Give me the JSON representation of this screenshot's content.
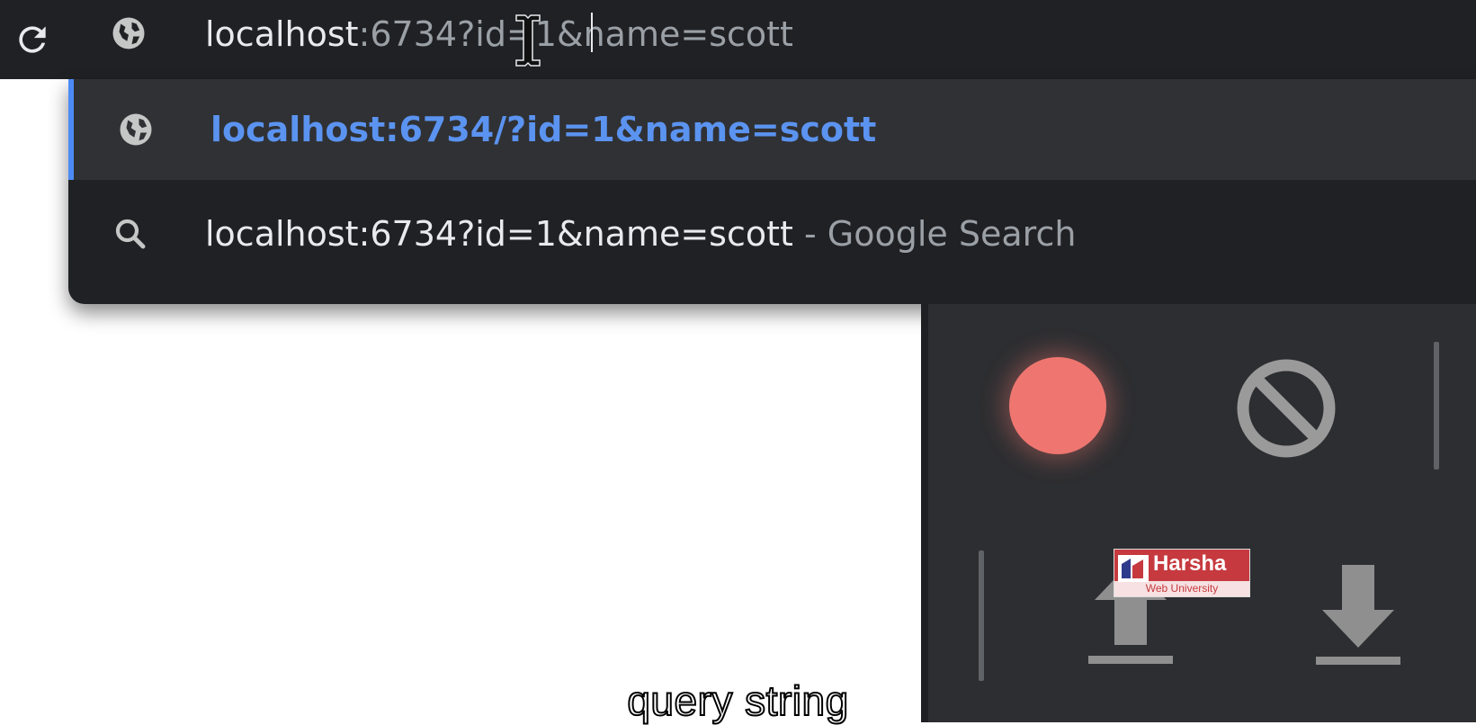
{
  "address_bar": {
    "host_text": "localhost",
    "rest_text": ":6734?id=1&name=scott",
    "icons": {
      "reload": "reload-icon",
      "site": "globe-icon"
    }
  },
  "suggestions": [
    {
      "icon": "globe-icon",
      "text": "localhost:6734/?id=1&name=scott",
      "selected": true
    },
    {
      "icon": "search-icon",
      "query": "localhost:6734?id=1&name=scott",
      "suffix": " - Google Search",
      "selected": false
    }
  ],
  "devtools": {
    "icons": [
      "record-icon",
      "clear-icon",
      "upload-icon",
      "download-icon"
    ],
    "record_color": "#ef7670"
  },
  "watermark": {
    "brand": "Harsha",
    "sub": "Web University"
  },
  "caption": "query string",
  "colors": {
    "accent": "#4c8bf5",
    "bar": "#202124",
    "selected_row": "#303134",
    "panel": "#2d2e31"
  }
}
